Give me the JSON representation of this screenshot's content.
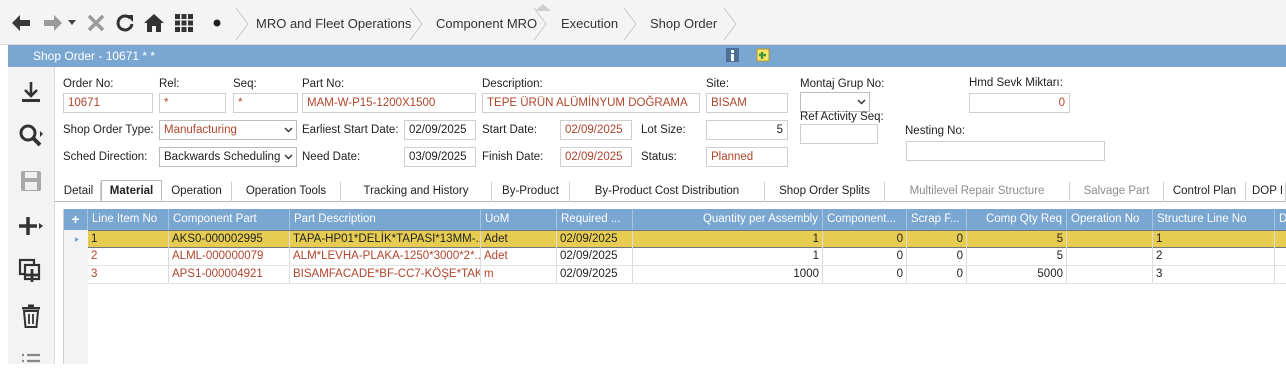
{
  "nav": {
    "breadcrumbs": [
      "MRO and Fleet Operations",
      "Component MRO",
      "Execution",
      "Shop Order"
    ],
    "icons": [
      "back-arrow-icon",
      "forward-arrow-icon",
      "dropdown-icon",
      "close-icon",
      "refresh-icon",
      "home-icon",
      "grid-menu-icon",
      "dot-icon"
    ]
  },
  "window": {
    "title": "Shop Order - 10671 * *"
  },
  "sidebar": {
    "icons": [
      "download-icon",
      "search-icon",
      "save-icon",
      "add-icon",
      "duplicate-icon",
      "delete-icon",
      "list-icon"
    ]
  },
  "form": {
    "order_no": {
      "label": "Order No:",
      "value": "10671"
    },
    "rel": {
      "label": "Rel:",
      "value": "*"
    },
    "seq": {
      "label": "Seq:",
      "value": "*"
    },
    "part_no": {
      "label": "Part No:",
      "value": "MAM-W-P15-1200X1500"
    },
    "description": {
      "label": "Description:",
      "value": "TEPE ÜRÜN ALÜMİNYUM DOĞRAMA"
    },
    "site": {
      "label": "Site:",
      "value": "BISAM"
    },
    "montaj_grup_no": {
      "label": "Montaj Grup No:",
      "value": ""
    },
    "hmd_sevk_miktari": {
      "label": "Hmd Sevk Miktarı:",
      "value": "0"
    },
    "shop_order_type": {
      "label": "Shop Order Type:",
      "value": "Manufacturing"
    },
    "earliest_start_date": {
      "label": "Earliest Start Date:",
      "value": "02/09/2025"
    },
    "start_date": {
      "label": "Start Date:",
      "value": "02/09/2025"
    },
    "lot_size": {
      "label": "Lot Size:",
      "value": "5"
    },
    "ref_activity_seq": {
      "label": "Ref Activity Seq:",
      "value": ""
    },
    "nesting_no": {
      "label": "Nesting No:",
      "value": ""
    },
    "sched_direction": {
      "label": "Sched Direction:",
      "value": "Backwards Scheduling"
    },
    "need_date": {
      "label": "Need Date:",
      "value": "03/09/2025"
    },
    "finish_date": {
      "label": "Finish Date:",
      "value": "02/09/2025"
    },
    "status": {
      "label": "Status:",
      "value": "Planned"
    }
  },
  "tabs": [
    {
      "label": "Detail"
    },
    {
      "label": "Material"
    },
    {
      "label": "Operation"
    },
    {
      "label": "Operation Tools"
    },
    {
      "label": "Tracking and History"
    },
    {
      "label": "By-Product"
    },
    {
      "label": "By-Product Cost Distribution"
    },
    {
      "label": "Shop Order Splits"
    },
    {
      "label": "Multilevel Repair Structure"
    },
    {
      "label": "Salvage Part"
    },
    {
      "label": "Control Plan"
    },
    {
      "label": "DOP I"
    }
  ],
  "active_tab": "Material",
  "grid": {
    "add_label": "+",
    "columns": [
      "Line Item No",
      "Component Part",
      "Part Description",
      "UoM",
      "Required ...",
      "Quantity per Assembly",
      "Component...",
      "Scrap F...",
      "Comp Qty Req",
      "Operation No",
      "Structure Line No",
      "D"
    ],
    "rows": [
      [
        "1",
        "AKS0-000002995",
        "TAPA-HP01*DELİK*TAPASI*13MM-...",
        "Adet",
        "02/09/2025",
        "1",
        "0",
        "0",
        "5",
        "",
        "1"
      ],
      [
        "2",
        "ALML-000000079",
        "ALM*LEVHA-PLAKA-1250*3000*2*...",
        "Adet",
        "02/09/2025",
        "1",
        "0",
        "0",
        "5",
        "",
        "2"
      ],
      [
        "3",
        "APS1-000004921",
        "BISAMFACADE*BF-CC7-KÖŞE*TAK...",
        "m",
        "02/09/2025",
        "1000",
        "0",
        "0",
        "5000",
        "",
        "3"
      ]
    ],
    "selected_row": 1
  }
}
